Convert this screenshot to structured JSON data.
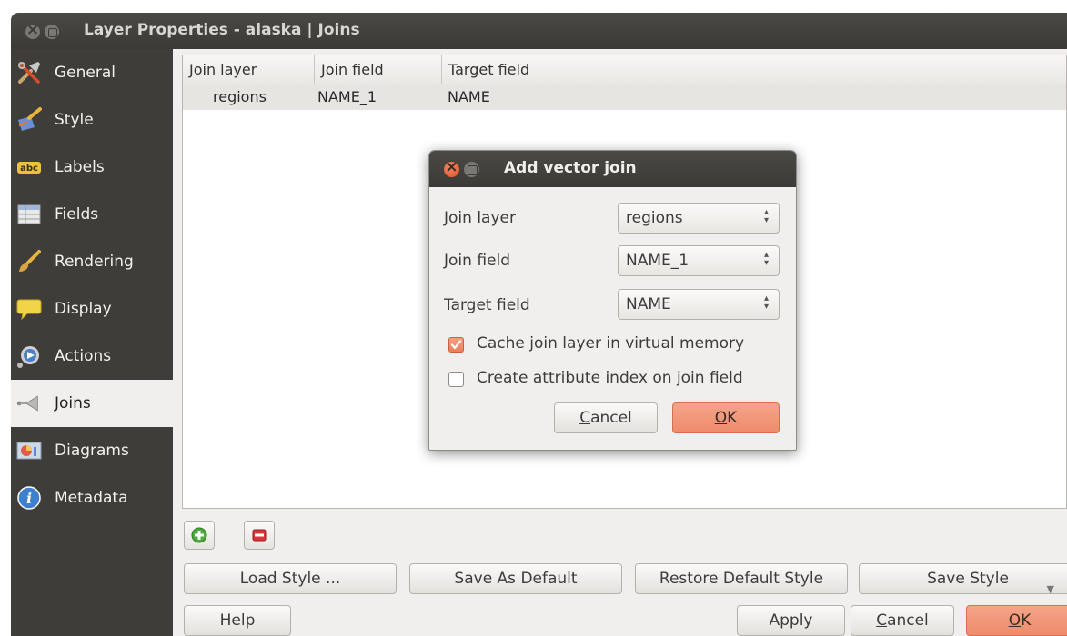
{
  "window": {
    "title": "Layer Properties - alaska | Joins"
  },
  "sidebar": {
    "items": [
      {
        "label": "General",
        "icon": "tools-icon"
      },
      {
        "label": "Style",
        "icon": "paintbrush-icon"
      },
      {
        "label": "Labels",
        "icon": "abc-label-icon"
      },
      {
        "label": "Fields",
        "icon": "table-icon"
      },
      {
        "label": "Rendering",
        "icon": "brush-icon"
      },
      {
        "label": "Display",
        "icon": "speech-bubble-icon"
      },
      {
        "label": "Actions",
        "icon": "gear-icon"
      },
      {
        "label": "Joins",
        "icon": "join-icon"
      },
      {
        "label": "Diagrams",
        "icon": "diagram-icon"
      },
      {
        "label": "Metadata",
        "icon": "info-icon"
      }
    ],
    "active": "Joins"
  },
  "joins_table": {
    "columns": [
      "Join layer",
      "Join field",
      "Target field"
    ],
    "rows": [
      {
        "join_layer": "regions",
        "join_field": "NAME_1",
        "target_field": "NAME"
      }
    ]
  },
  "bottom_buttons": {
    "load_style": "Load Style ...",
    "save_as_default": "Save As Default",
    "restore_default_style": "Restore Default Style",
    "save_style": "Save Style",
    "help": "Help",
    "apply": "Apply",
    "cancel_pre": "",
    "cancel_u": "C",
    "cancel_post": "ancel",
    "ok_u": "O",
    "ok_post": "K"
  },
  "dialog": {
    "title": "Add vector join",
    "join_layer_label": "Join layer",
    "join_layer_value": "regions",
    "join_field_label": "Join field",
    "join_field_value": "NAME_1",
    "target_field_label": "Target field",
    "target_field_value": "NAME",
    "cache_label": "Cache join layer in virtual memory",
    "cache_checked": true,
    "index_label": "Create attribute index on join field",
    "index_checked": false,
    "cancel_u": "C",
    "cancel_post": "ancel",
    "ok_u": "O",
    "ok_post": "K"
  },
  "colors": {
    "titlebar": "#3b3a36",
    "sidebar": "#3e3d39",
    "accent": "#ee8b6c",
    "background": "#f0efed"
  }
}
